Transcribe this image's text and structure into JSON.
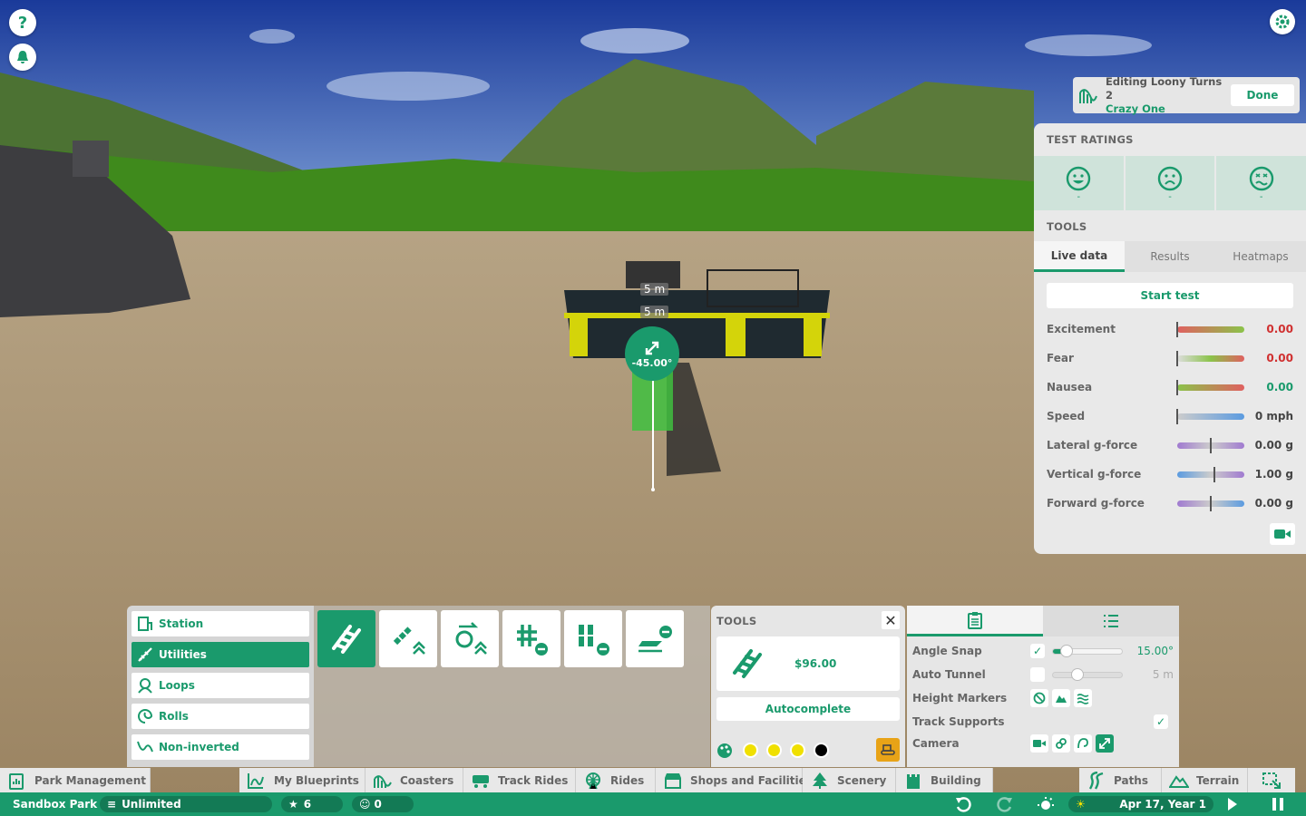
{
  "hud": {
    "help_icon": "question-icon",
    "alert_icon": "bell-icon",
    "settings_icon": "gear-icon"
  },
  "scene": {
    "marker_top": "5 m",
    "marker_bottom": "5 m",
    "angle_label": "-45.00°"
  },
  "editing": {
    "line1": "Editing Loony Turns 2",
    "line2": "Crazy One",
    "done_label": "Done"
  },
  "test_ratings": {
    "title": "TEST RATINGS",
    "cells": [
      {
        "icon": "happy-face-icon",
        "value": "-"
      },
      {
        "icon": "worried-face-icon",
        "value": "-"
      },
      {
        "icon": "sick-face-icon",
        "value": "-"
      }
    ]
  },
  "tools": {
    "title": "TOOLS",
    "tabs": [
      "Live data",
      "Results",
      "Heatmaps"
    ],
    "active_tab": "Live data",
    "start_test_label": "Start test",
    "stats": [
      {
        "label": "Excitement",
        "value": "0.00",
        "marker": 0.0
      },
      {
        "label": "Fear",
        "value": "0.00",
        "marker": 0.0
      },
      {
        "label": "Nausea",
        "value": "0.00",
        "marker": 0.0
      },
      {
        "label": "Speed",
        "value": "0 mph",
        "marker": 0.0
      },
      {
        "label": "Lateral g-force",
        "value": "0.00 g",
        "marker": 0.5
      },
      {
        "label": "Vertical g-force",
        "value": "1.00 g",
        "marker": 0.55
      },
      {
        "label": "Forward g-force",
        "value": "0.00 g",
        "marker": 0.5
      }
    ]
  },
  "categories": [
    {
      "label": "Station",
      "icon": "station-icon"
    },
    {
      "label": "Utilities",
      "icon": "wrench-track-icon",
      "active": true
    },
    {
      "label": "Loops",
      "icon": "loop-icon"
    },
    {
      "label": "Rolls",
      "icon": "roll-icon"
    },
    {
      "label": "Non-inverted",
      "icon": "non-inverted-icon"
    }
  ],
  "toolstrip": [
    "track-piece-icon",
    "chain-lift-icon",
    "booster-icon",
    "brake-remove-icon",
    "block-brake-remove-icon",
    "launch-remove-icon"
  ],
  "tools_panel": {
    "title": "TOOLS",
    "price": "$96.00",
    "autocomplete_label": "Autocomplete",
    "colors": [
      "#f0e000",
      "#f0e000",
      "#f0e000",
      "#000000"
    ]
  },
  "options": {
    "angle_snap": {
      "label": "Angle Snap",
      "value": "15.00°",
      "checked": true,
      "level": 0.2
    },
    "auto_tunnel": {
      "label": "Auto Tunnel",
      "value": "5 m",
      "checked": false,
      "level": 0.35
    },
    "height_markers": {
      "label": "Height Markers"
    },
    "track_supports": {
      "label": "Track Supports",
      "checked": true
    },
    "camera": {
      "label": "Camera"
    }
  },
  "nav": [
    {
      "label": "Park Management",
      "icon": "park-management-icon"
    },
    {
      "label": "My Blueprints",
      "icon": "blueprint-icon"
    },
    {
      "label": "Coasters",
      "icon": "coaster-icon"
    },
    {
      "label": "Track Rides",
      "icon": "track-ride-icon"
    },
    {
      "label": "Rides",
      "icon": "ferris-wheel-icon"
    },
    {
      "label": "Shops and Facilities",
      "icon": "shop-icon"
    },
    {
      "label": "Scenery",
      "icon": "tree-icon"
    },
    {
      "label": "Building",
      "icon": "castle-icon"
    },
    {
      "label": "Paths",
      "icon": "path-icon"
    },
    {
      "label": "Terrain",
      "icon": "terrain-icon"
    }
  ],
  "status": {
    "park_name": "Sandbox Park",
    "money": "Unlimited",
    "rating": "6",
    "guests": "0",
    "date": "Apr 17, Year 1"
  }
}
